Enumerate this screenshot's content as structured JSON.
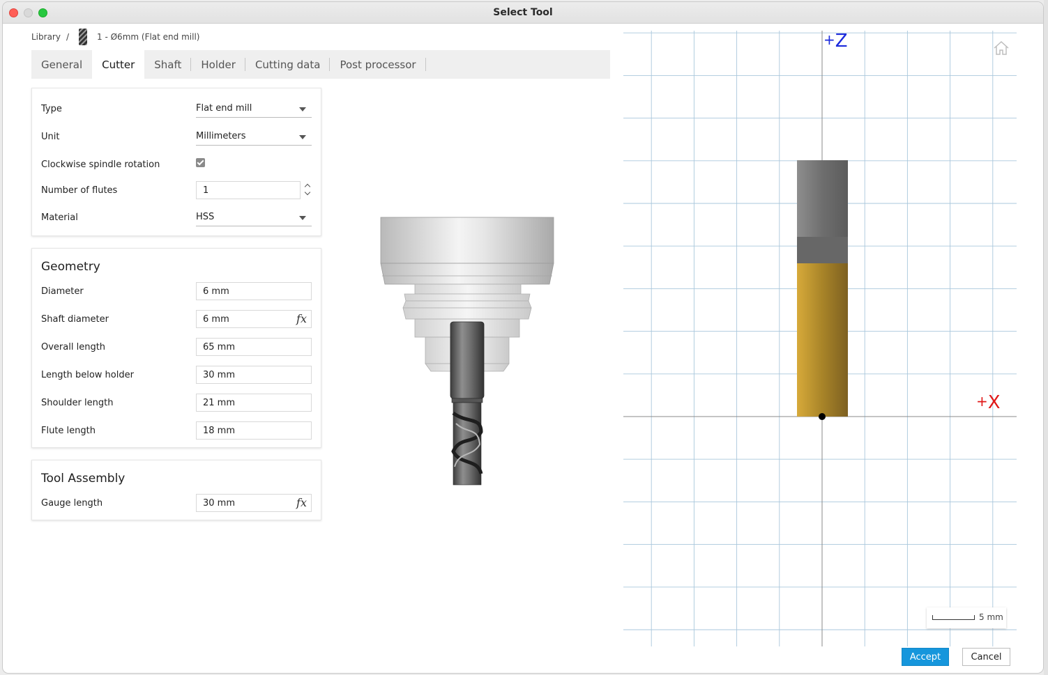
{
  "window": {
    "title": "Select Tool"
  },
  "breadcrumb": {
    "root": "Library",
    "separator": "/",
    "tool": "1 - Ø6mm (Flat end mill)"
  },
  "tabs": [
    {
      "label": "General",
      "active": false
    },
    {
      "label": "Cutter",
      "active": true
    },
    {
      "label": "Shaft",
      "active": false
    },
    {
      "label": "Holder",
      "active": false
    },
    {
      "label": "Cutting data",
      "active": false
    },
    {
      "label": "Post processor",
      "active": false
    }
  ],
  "cutter": {
    "type": {
      "label": "Type",
      "value": "Flat end mill"
    },
    "unit": {
      "label": "Unit",
      "value": "Millimeters"
    },
    "clockwise": {
      "label": "Clockwise spindle rotation",
      "checked": true
    },
    "flutes": {
      "label": "Number of flutes",
      "value": "1"
    },
    "material": {
      "label": "Material",
      "value": "HSS"
    }
  },
  "geometry": {
    "title": "Geometry",
    "diameter": {
      "label": "Diameter",
      "value": "6 mm"
    },
    "shaft_diameter": {
      "label": "Shaft diameter",
      "value": "6 mm",
      "fx": "fx"
    },
    "overall_length": {
      "label": "Overall length",
      "value": "65 mm"
    },
    "length_below_holder": {
      "label": "Length below holder",
      "value": "30 mm"
    },
    "shoulder_length": {
      "label": "Shoulder length",
      "value": "21 mm"
    },
    "flute_length": {
      "label": "Flute length",
      "value": "18 mm"
    }
  },
  "assembly": {
    "title": "Tool Assembly",
    "gauge_length": {
      "label": "Gauge length",
      "value": "30 mm",
      "fx": "fx"
    }
  },
  "view2d": {
    "axis_z": "Z",
    "axis_z_sign": "+",
    "axis_x": "X",
    "axis_x_sign": "+",
    "scale_label": "5 mm",
    "colors": {
      "grid": "#a9c7dc",
      "axis": "#8a8a8a",
      "shaft": "#777777",
      "flute": "#c99a2c",
      "z_axis": "#1c2bdc",
      "x_axis": "#e01818"
    }
  },
  "buttons": {
    "accept": "Accept",
    "cancel": "Cancel"
  },
  "colors": {
    "accent": "#1696dc"
  }
}
